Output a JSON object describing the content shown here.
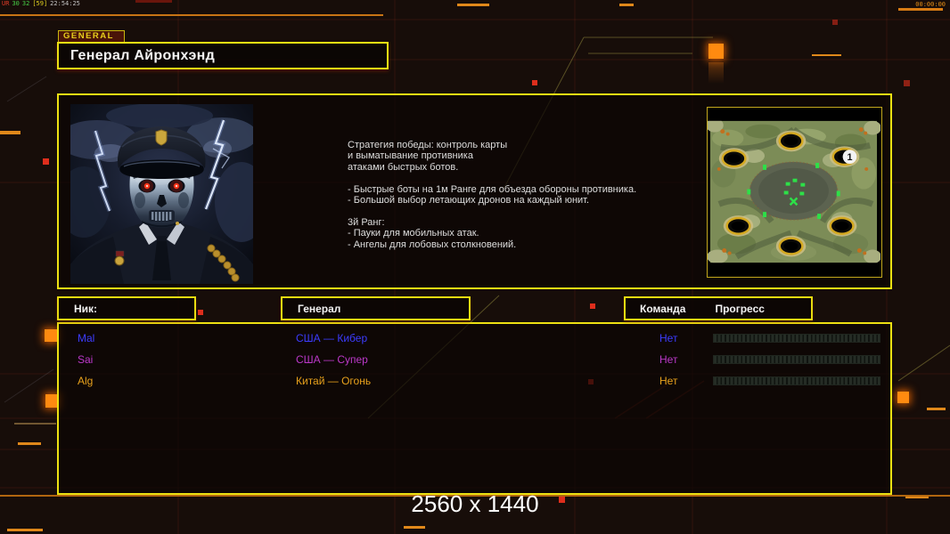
{
  "perf_overlay": {
    "label": "UR",
    "value_a": "30",
    "value_b": "32",
    "value_c": "[59]",
    "clock": "22:54:25"
  },
  "match_timer": "00:00:00",
  "general_tab_label": "GENERAL",
  "general_name": "Генерал Айронхэнд",
  "general_description": "Стратегия победы: контроль карты\nи выматывание противника\nатаками быстрых ботов.\n\n- Быстрые боты на 1м Ранге для объезда обороны противника.\n- Большой выбор летающих дронов на каждый юнит.\n\n3й Ранг:\n- Пауки для мобильных атак.\n- Ангелы для лобовых столкновений.",
  "minimap": {
    "start_marker": "1"
  },
  "roster": {
    "headers": {
      "nick": "Ник:",
      "general": "Генерал",
      "team": "Команда",
      "progress": "Прогресс"
    },
    "players": [
      {
        "nick": "Mal",
        "general": "США — Кибер",
        "team": "Нет",
        "color": "#3c3cff",
        "progress_percent": 0
      },
      {
        "nick": "Sai",
        "general": "США — Супер",
        "team": "Нет",
        "color": "#bb38c8",
        "progress_percent": 0
      },
      {
        "nick": "Alg",
        "general": "Китай — Огонь",
        "team": "Нет",
        "color": "#e8a11c",
        "progress_percent": 0
      }
    ]
  },
  "resolution_label": "2560 x 1440",
  "colors": {
    "accent_yellow": "#ede112",
    "accent_orange": "#e0881a",
    "alert_red": "#de2e1c"
  }
}
